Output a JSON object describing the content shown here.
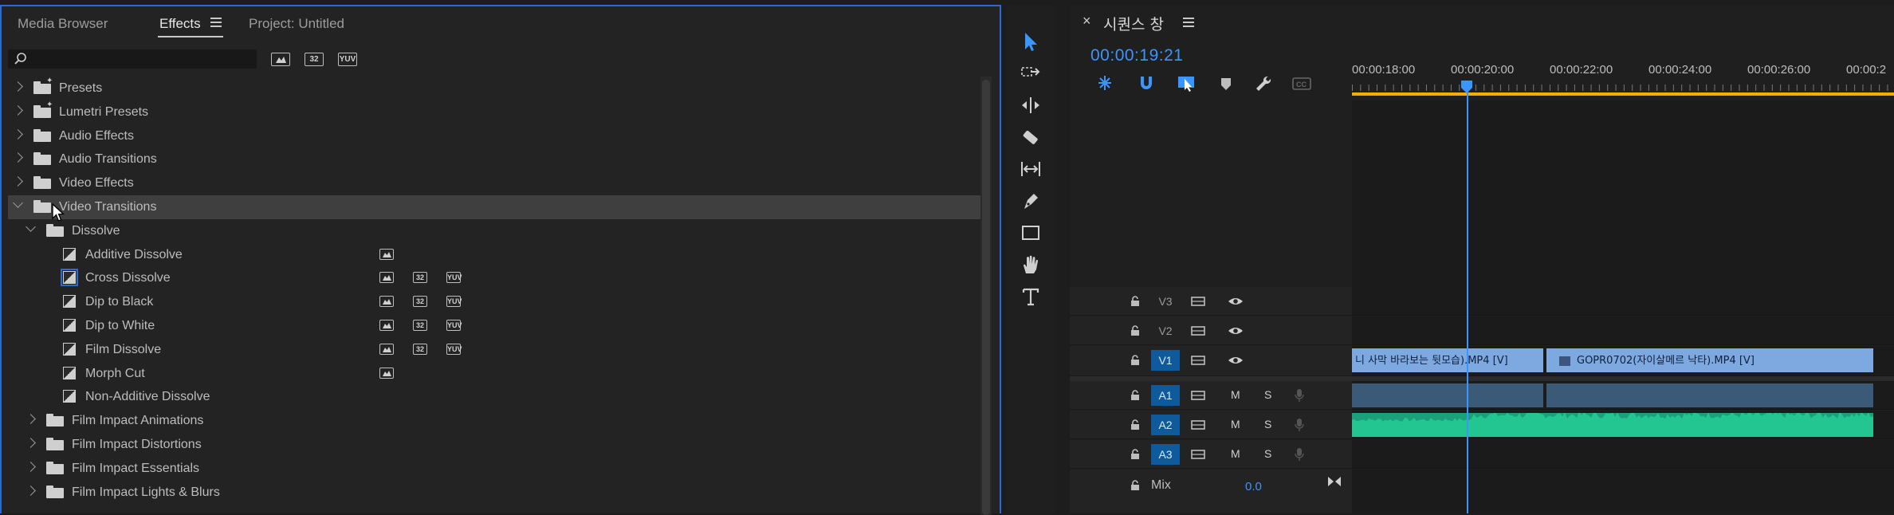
{
  "effects_panel": {
    "tabs": [
      {
        "label": "Media Browser",
        "active": false
      },
      {
        "label": "Effects",
        "active": true
      },
      {
        "label": "Project: Untitled",
        "active": false
      }
    ],
    "search": {
      "value": "",
      "placeholder": ""
    },
    "filter_badges": [
      "accelerated-effects-icon",
      "32",
      "YUV"
    ],
    "tree": [
      {
        "label": "Presets",
        "type": "folder-star",
        "expanded": false,
        "level": 0
      },
      {
        "label": "Lumetri Presets",
        "type": "folder-star",
        "expanded": false,
        "level": 0
      },
      {
        "label": "Audio Effects",
        "type": "folder",
        "expanded": false,
        "level": 0
      },
      {
        "label": "Audio Transitions",
        "type": "folder",
        "expanded": false,
        "level": 0
      },
      {
        "label": "Video Effects",
        "type": "folder",
        "expanded": false,
        "level": 0
      },
      {
        "label": "Video Transitions",
        "type": "folder",
        "expanded": true,
        "level": 0,
        "selected": true
      },
      {
        "label": "Dissolve",
        "type": "folder",
        "expanded": true,
        "level": 1
      },
      {
        "label": "Additive Dissolve",
        "type": "transition",
        "level": 2,
        "badges": [
          "acc"
        ]
      },
      {
        "label": "Cross Dissolve",
        "type": "transition",
        "level": 2,
        "badges": [
          "acc",
          "32",
          "YUV"
        ],
        "highlighted": true
      },
      {
        "label": "Dip to Black",
        "type": "transition",
        "level": 2,
        "badges": [
          "acc",
          "32",
          "YUV"
        ]
      },
      {
        "label": "Dip to White",
        "type": "transition",
        "level": 2,
        "badges": [
          "acc",
          "32",
          "YUV"
        ]
      },
      {
        "label": "Film Dissolve",
        "type": "transition",
        "level": 2,
        "badges": [
          "acc",
          "32",
          "YUV"
        ]
      },
      {
        "label": "Morph Cut",
        "type": "transition",
        "level": 2,
        "badges": [
          "acc"
        ]
      },
      {
        "label": "Non-Additive Dissolve",
        "type": "transition",
        "level": 2,
        "badges": []
      },
      {
        "label": "Film Impact Animations",
        "type": "folder",
        "expanded": false,
        "level": 1
      },
      {
        "label": "Film Impact Distortions",
        "type": "folder",
        "expanded": false,
        "level": 1
      },
      {
        "label": "Film Impact Essentials",
        "type": "folder",
        "expanded": false,
        "level": 1
      },
      {
        "label": "Film Impact Lights & Blurs",
        "type": "folder",
        "expanded": false,
        "level": 1
      }
    ]
  },
  "tools": [
    "selection-tool-icon",
    "track-select-tool-icon",
    "ripple-edit-tool-icon",
    "razor-tool-icon",
    "slip-tool-icon",
    "pen-tool-icon",
    "rectangle-tool-icon",
    "hand-tool-icon",
    "type-tool-icon"
  ],
  "timeline": {
    "close_glyph": "×",
    "sequence_name": "시퀀스 창",
    "timecode": "00:00:19:21",
    "ruler_labels": [
      "00:00:18:00",
      "00:00:20:00",
      "00:00:22:00",
      "00:00:24:00",
      "00:00:26:00",
      "00:00:2"
    ],
    "video_tracks": [
      {
        "name": "V3",
        "selected": false
      },
      {
        "name": "V2",
        "selected": false
      },
      {
        "name": "V1",
        "selected": true
      }
    ],
    "audio_tracks": [
      {
        "name": "A1",
        "m": "M",
        "s": "S"
      },
      {
        "name": "A2",
        "m": "M",
        "s": "S"
      },
      {
        "name": "A3",
        "m": "M",
        "s": "S"
      }
    ],
    "mix": {
      "label": "Mix",
      "value": "0.0"
    },
    "clips": {
      "v1_left": "니 사막 바라보는 뒷모습).MP4 [V]",
      "v1_right": "GOPR0702(자이살메르 낙타).MP4 [V]"
    },
    "colors": {
      "accent": "#3b95ff",
      "video_clip": "#7ea9e0",
      "audio_clip": "#1aa07a",
      "work_area": "#f0b000"
    }
  }
}
